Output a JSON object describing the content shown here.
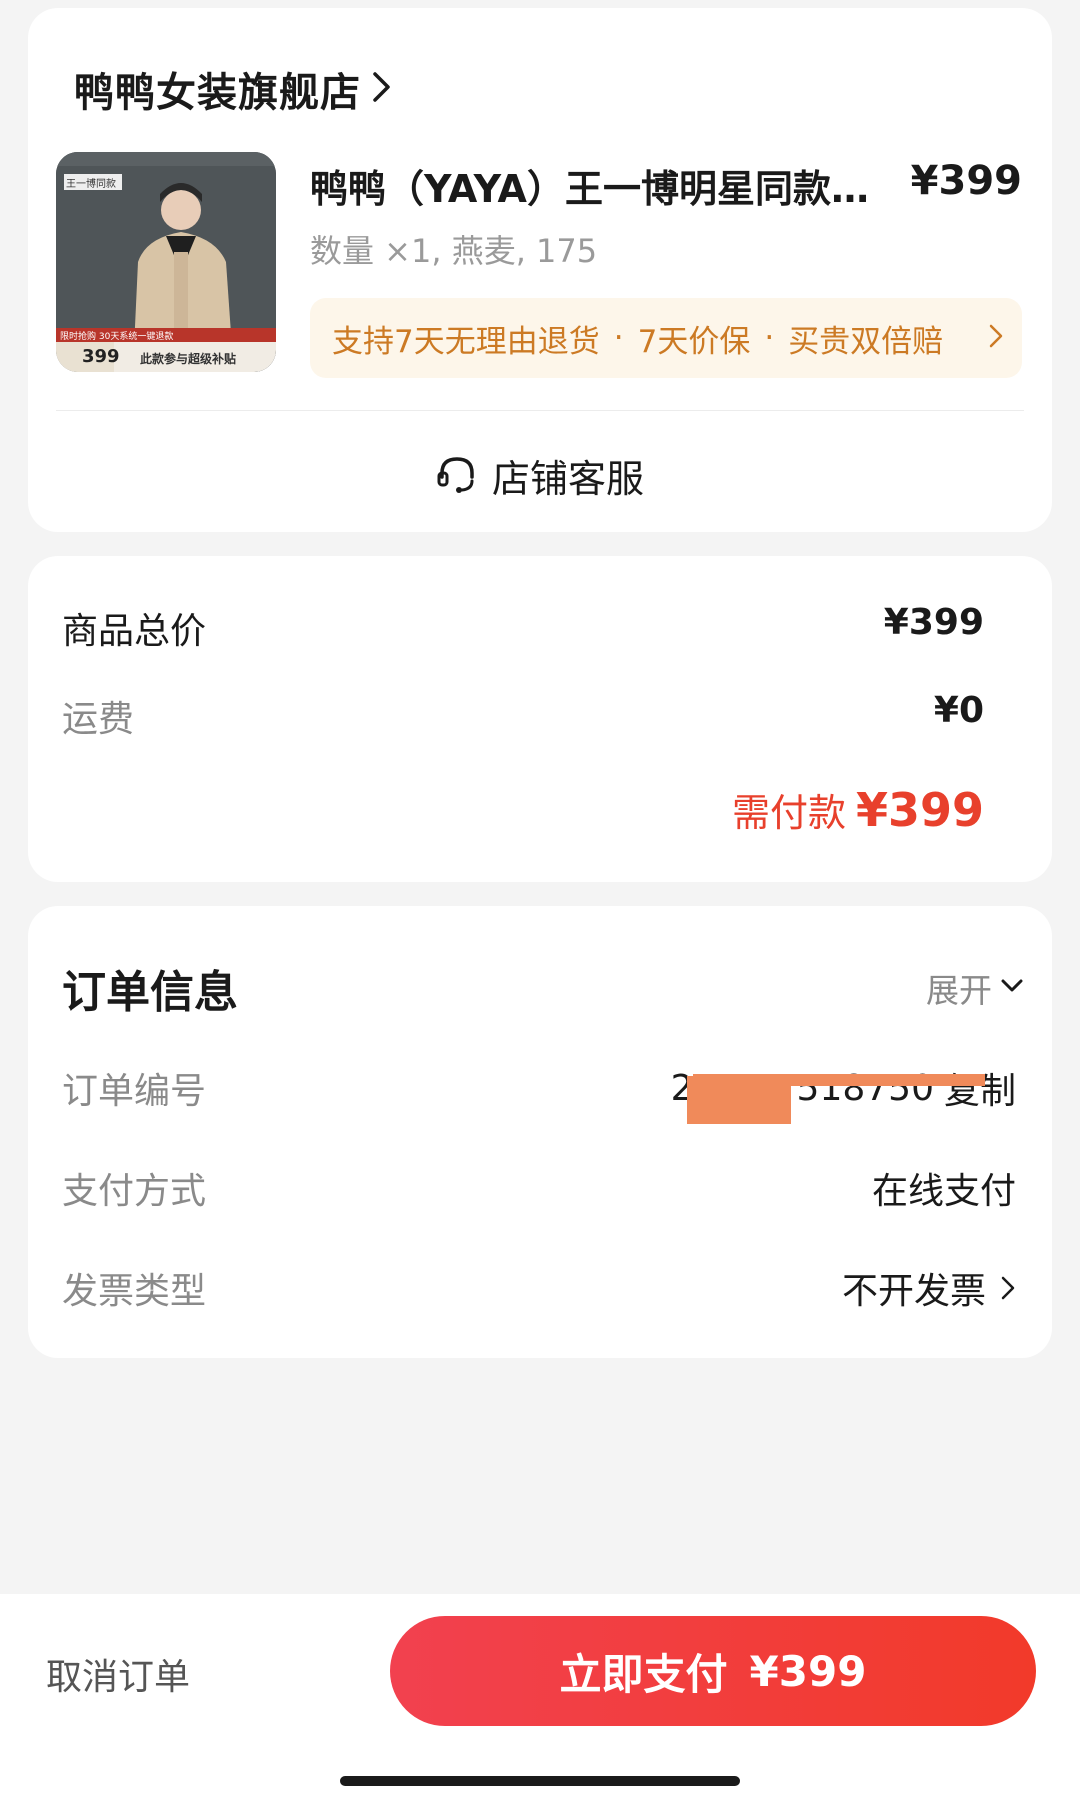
{
  "shop": {
    "name": "鸭鸭女装旗舰店"
  },
  "product": {
    "title": "鸭鸭（YAYA）王一博明星同款…",
    "price": "¥399",
    "spec": "数量 ×1, 燕麦, 175",
    "thumb_text": {
      "tag": "王一博同款",
      "promo": "限时抢购 30天系统一键退款",
      "price": "399",
      "subsidy": "此款参与超级补贴"
    },
    "services": [
      "支持7天无理由退货",
      "7天价保",
      "买贵双倍赔"
    ],
    "service_sep": "·"
  },
  "customer_service": {
    "label": "店铺客服"
  },
  "totals": {
    "goods_label": "商品总价",
    "goods_value": "¥399",
    "shipping_label": "运费",
    "shipping_value": "¥0",
    "due_label": "需付款",
    "due_value": "¥399"
  },
  "order_info": {
    "title": "订单信息",
    "expand_label": "展开",
    "order_no_label": "订单编号",
    "order_no_value": "2         518750",
    "copy_label": "复制",
    "payment_label": "支付方式",
    "payment_value": "在线支付",
    "invoice_label": "发票类型",
    "invoice_value": "不开发票"
  },
  "bottom": {
    "cancel_label": "取消订单",
    "pay_label": "立即支付",
    "pay_value": "¥399"
  },
  "colors": {
    "accent_red": "#f23a2a",
    "service_orange": "#cc7a24",
    "due_red": "#e8402c"
  },
  "icons": [
    "chevron-right-icon",
    "headset-icon",
    "chevron-down-icon"
  ]
}
